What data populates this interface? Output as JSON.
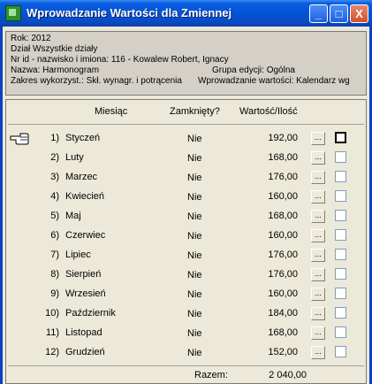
{
  "window": {
    "title": "Wprowadzanie Wartości dla Zmiennej",
    "minimize": "_",
    "maximize": "□",
    "close": "X"
  },
  "info": {
    "rok": "Rok: 2012",
    "dzial": "Dział   Wszystkie działy",
    "nr_id": "Nr id - nazwisko i imiona: 116 - Kowalew Robert, Ignacy",
    "nazwa": "Nazwa:    Harmonogram",
    "grupa": "Grupa edycji:   Ogólna",
    "zakres": "Zakres wykorzyst.: Skł. wynagr. i potrącenia",
    "wprowadzanie": "Wprowadzanie wartości: Kalendarz wg"
  },
  "grid": {
    "headers": {
      "miesiac": "Miesiąc",
      "zamkniety": "Zamknięty?",
      "wartosc": "Wartość/Ilość"
    },
    "rows": [
      {
        "num": "1)",
        "month": "Styczeń",
        "closed": "Nie",
        "value": "192,00"
      },
      {
        "num": "2)",
        "month": "Luty",
        "closed": "Nie",
        "value": "168,00"
      },
      {
        "num": "3)",
        "month": "Marzec",
        "closed": "Nie",
        "value": "176,00"
      },
      {
        "num": "4)",
        "month": "Kwiecień",
        "closed": "Nie",
        "value": "160,00"
      },
      {
        "num": "5)",
        "month": "Maj",
        "closed": "Nie",
        "value": "168,00"
      },
      {
        "num": "6)",
        "month": "Czerwiec",
        "closed": "Nie",
        "value": "160,00"
      },
      {
        "num": "7)",
        "month": "Lipiec",
        "closed": "Nie",
        "value": "176,00"
      },
      {
        "num": "8)",
        "month": "Sierpień",
        "closed": "Nie",
        "value": "176,00"
      },
      {
        "num": "9)",
        "month": "Wrzesień",
        "closed": "Nie",
        "value": "160,00"
      },
      {
        "num": "10)",
        "month": "Październik",
        "closed": "Nie",
        "value": "184,00"
      },
      {
        "num": "11)",
        "month": "Listopad",
        "closed": "Nie",
        "value": "168,00"
      },
      {
        "num": "12)",
        "month": "Grudzień",
        "closed": "Nie",
        "value": "152,00"
      }
    ],
    "ellipsis": "...",
    "razem_label": "Razem:",
    "razem_value": "2 040,00"
  }
}
